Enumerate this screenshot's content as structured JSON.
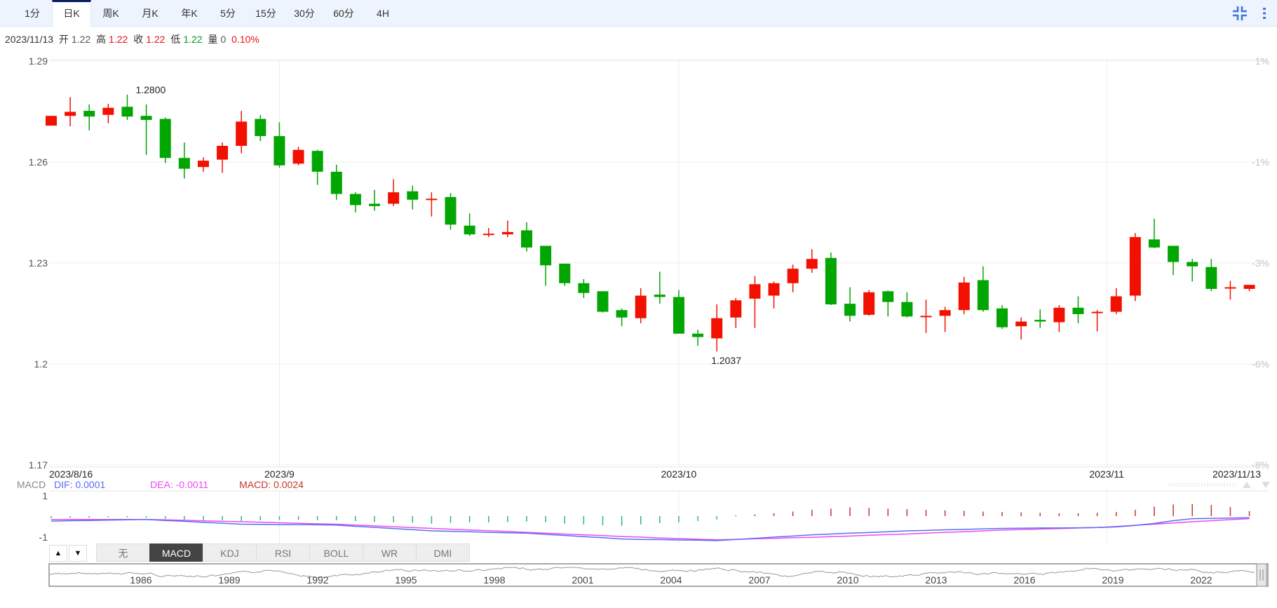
{
  "tabs": [
    "1分",
    "日K",
    "周K",
    "月K",
    "年K",
    "5分",
    "15分",
    "30分",
    "60分",
    "4H"
  ],
  "active_tab": "日K",
  "toolbar": {
    "compress_icon": "compress-icon",
    "more_icon": "more-vertical-icon"
  },
  "info": {
    "date": "2023/11/13",
    "open_label": "开",
    "open": "1.22",
    "high_label": "高",
    "high": "1.22",
    "close_label": "收",
    "close": "1.22",
    "low_label": "低",
    "low": "1.22",
    "volume_label": "量",
    "volume": "0",
    "change": "0.10%"
  },
  "colors": {
    "up": "#f21100",
    "down": "#02a602",
    "dif": "#5b6cf5",
    "dea": "#e84cf0",
    "macd_up": "#c0392b",
    "macd_down": "#2bb38a"
  },
  "chart_data": {
    "type": "candlestick",
    "ylim": [
      1.17,
      1.29
    ],
    "y_ticks": [
      "1.29",
      "1.26",
      "1.23",
      "1.2",
      "1.17"
    ],
    "y_tick_values": [
      1.29,
      1.26,
      1.23,
      1.2,
      1.17
    ],
    "pct_ticks": [
      "1%",
      "-1%",
      "-3%",
      "-6%",
      "-8%"
    ],
    "x_labels": {
      "start": "2023/8/16",
      "m1": "2023/9",
      "m2": "2023/10",
      "m3": "2023/11",
      "end": "2023/11/13"
    },
    "x_month_index": [
      12,
      33,
      55.5
    ],
    "annotations": {
      "max_label": "1.2800",
      "max_index": 4,
      "min_label": "1.2037",
      "min_index": 35
    },
    "ohlc": [
      [
        1.2708,
        1.2737,
        1.2708,
        1.2737
      ],
      [
        1.2737,
        1.2793,
        1.2706,
        1.2749
      ],
      [
        1.2752,
        1.2771,
        1.2694,
        1.2735
      ],
      [
        1.274,
        1.2773,
        1.2715,
        1.2761
      ],
      [
        1.2764,
        1.28,
        1.2725,
        1.2735
      ],
      [
        1.2737,
        1.2771,
        1.2621,
        1.2725
      ],
      [
        1.2728,
        1.2732,
        1.2597,
        1.2612
      ],
      [
        1.2612,
        1.2658,
        1.2551,
        1.258
      ],
      [
        1.2585,
        1.2614,
        1.2571,
        1.2604
      ],
      [
        1.2607,
        1.2658,
        1.2568,
        1.2648
      ],
      [
        1.2648,
        1.2752,
        1.2626,
        1.272
      ],
      [
        1.2728,
        1.274,
        1.2662,
        1.2677
      ],
      [
        1.2677,
        1.2718,
        1.2583,
        1.259
      ],
      [
        1.2595,
        1.2645,
        1.259,
        1.2636
      ],
      [
        1.2633,
        1.2636,
        1.2532,
        1.2571
      ],
      [
        1.2571,
        1.2592,
        1.2488,
        1.2505
      ],
      [
        1.2505,
        1.251,
        1.245,
        1.2472
      ],
      [
        1.2476,
        1.2517,
        1.2455,
        1.2469
      ],
      [
        1.2476,
        1.2549,
        1.2469,
        1.251
      ],
      [
        1.2513,
        1.253,
        1.2459,
        1.2488
      ],
      [
        1.2491,
        1.251,
        1.2438,
        1.2491
      ],
      [
        1.2496,
        1.2508,
        1.2399,
        1.2414
      ],
      [
        1.2411,
        1.2447,
        1.238,
        1.2385
      ],
      [
        1.2387,
        1.2404,
        1.2377,
        1.2387
      ],
      [
        1.2385,
        1.2426,
        1.2377,
        1.2392
      ],
      [
        1.2397,
        1.2421,
        1.2334,
        1.2346
      ],
      [
        1.2351,
        1.2351,
        1.2232,
        1.2293
      ],
      [
        1.2298,
        1.2298,
        1.2232,
        1.224
      ],
      [
        1.224,
        1.2252,
        1.2196,
        1.2211
      ],
      [
        1.2216,
        1.2216,
        1.2153,
        1.2155
      ],
      [
        1.216,
        1.2165,
        1.2112,
        1.2138
      ],
      [
        1.2136,
        1.2225,
        1.2121,
        1.2203
      ],
      [
        1.2206,
        1.2274,
        1.2179,
        1.2199
      ],
      [
        1.2199,
        1.222,
        1.209,
        1.209
      ],
      [
        1.209,
        1.2102,
        1.2054,
        1.208
      ],
      [
        1.2076,
        1.2177,
        1.2037,
        1.2136
      ],
      [
        1.2138,
        1.2196,
        1.2107,
        1.2189
      ],
      [
        1.2194,
        1.2261,
        1.2107,
        1.2237
      ],
      [
        1.2203,
        1.2245,
        1.2165,
        1.224
      ],
      [
        1.224,
        1.2295,
        1.2213,
        1.2283
      ],
      [
        1.2283,
        1.2341,
        1.2271,
        1.2312
      ],
      [
        1.2315,
        1.2331,
        1.2175,
        1.2177
      ],
      [
        1.2179,
        1.2228,
        1.2126,
        1.2143
      ],
      [
        1.2146,
        1.222,
        1.2143,
        1.2213
      ],
      [
        1.2216,
        1.2218,
        1.2141,
        1.2184
      ],
      [
        1.2184,
        1.2213,
        1.2138,
        1.2141
      ],
      [
        1.2143,
        1.2191,
        1.2092,
        1.2143
      ],
      [
        1.2143,
        1.217,
        1.2095,
        1.216
      ],
      [
        1.216,
        1.2259,
        1.2148,
        1.2242
      ],
      [
        1.2249,
        1.229,
        1.2155,
        1.216
      ],
      [
        1.2165,
        1.2175,
        1.2104,
        1.2109
      ],
      [
        1.2112,
        1.2138,
        1.2073,
        1.2126
      ],
      [
        1.2131,
        1.2162,
        1.2107,
        1.2126
      ],
      [
        1.2124,
        1.2175,
        1.2095,
        1.2167
      ],
      [
        1.2167,
        1.2201,
        1.2121,
        1.2148
      ],
      [
        1.2155,
        1.216,
        1.2097,
        1.2155
      ],
      [
        1.2155,
        1.2225,
        1.2148,
        1.2201
      ],
      [
        1.2203,
        1.2389,
        1.2187,
        1.2377
      ],
      [
        1.237,
        1.2431,
        1.2344,
        1.2346
      ],
      [
        1.2351,
        1.2351,
        1.2264,
        1.2303
      ],
      [
        1.2303,
        1.2312,
        1.2245,
        1.229
      ],
      [
        1.2288,
        1.2312,
        1.2216,
        1.2223
      ],
      [
        1.2228,
        1.2247,
        1.2191,
        1.2228
      ],
      [
        1.2223,
        1.2235,
        1.2216,
        1.2235
      ]
    ],
    "ohlc_order": "open,high,low,close"
  },
  "macd": {
    "title": "MACD",
    "dif_label": "DIF: 0.0001",
    "dea_label": "DEA: -0.0011",
    "macd_label": "MACD: 0.0024",
    "y_ticks": [
      "1",
      "-1"
    ],
    "dif": [
      -0.24,
      -0.22,
      -0.21,
      -0.19,
      -0.18,
      -0.16,
      -0.21,
      -0.25,
      -0.3,
      -0.34,
      -0.39,
      -0.4,
      -0.41,
      -0.41,
      -0.42,
      -0.43,
      -0.49,
      -0.54,
      -0.6,
      -0.65,
      -0.71,
      -0.73,
      -0.75,
      -0.78,
      -0.8,
      -0.82,
      -0.88,
      -0.93,
      -0.99,
      -1.04,
      -1.1,
      -1.12,
      -1.13,
      -1.15,
      -1.16,
      -1.18,
      -1.12,
      -1.07,
      -1.01,
      -0.96,
      -0.9,
      -0.86,
      -0.82,
      -0.79,
      -0.75,
      -0.71,
      -0.69,
      -0.66,
      -0.64,
      -0.61,
      -0.59,
      -0.58,
      -0.57,
      -0.57,
      -0.56,
      -0.55,
      -0.52,
      -0.45,
      -0.35,
      -0.22,
      -0.12,
      -0.11,
      -0.09,
      -0.08
    ],
    "dea": [
      -0.16,
      -0.16,
      -0.16,
      -0.16,
      -0.16,
      -0.16,
      -0.18,
      -0.2,
      -0.23,
      -0.25,
      -0.27,
      -0.29,
      -0.32,
      -0.34,
      -0.37,
      -0.39,
      -0.43,
      -0.47,
      -0.51,
      -0.55,
      -0.59,
      -0.63,
      -0.67,
      -0.7,
      -0.74,
      -0.78,
      -0.82,
      -0.86,
      -0.9,
      -0.94,
      -0.98,
      -1.01,
      -1.05,
      -1.08,
      -1.11,
      -1.14,
      -1.12,
      -1.09,
      -1.07,
      -1.04,
      -1.02,
      -0.99,
      -0.96,
      -0.92,
      -0.89,
      -0.86,
      -0.82,
      -0.78,
      -0.75,
      -0.71,
      -0.67,
      -0.65,
      -0.62,
      -0.6,
      -0.57,
      -0.55,
      -0.5,
      -0.44,
      -0.39,
      -0.33,
      -0.27,
      -0.22,
      -0.17,
      -0.12
    ],
    "hist": [
      -0.1,
      -0.08,
      -0.08,
      -0.06,
      -0.06,
      -0.08,
      -0.12,
      -0.16,
      -0.2,
      -0.2,
      -0.24,
      -0.2,
      -0.18,
      -0.18,
      -0.2,
      -0.2,
      -0.24,
      -0.28,
      -0.3,
      -0.32,
      -0.36,
      -0.32,
      -0.3,
      -0.3,
      -0.28,
      -0.26,
      -0.3,
      -0.36,
      -0.4,
      -0.44,
      -0.46,
      -0.4,
      -0.34,
      -0.3,
      -0.24,
      -0.16,
      0.04,
      0.08,
      0.14,
      0.22,
      0.3,
      0.36,
      0.42,
      0.4,
      0.36,
      0.34,
      0.3,
      0.28,
      0.26,
      0.22,
      0.2,
      0.18,
      0.16,
      0.14,
      0.14,
      0.16,
      0.2,
      0.3,
      0.46,
      0.56,
      0.58,
      0.54,
      0.44,
      0.24
    ]
  },
  "indicator_tabs": [
    "无",
    "MACD",
    "KDJ",
    "RSI",
    "BOLL",
    "WR",
    "DMI"
  ],
  "active_indicator": "MACD",
  "pane_buttons": {
    "up": "▲",
    "down": "▼"
  },
  "navigator": {
    "years": [
      "1986",
      "1989",
      "1992",
      "1995",
      "1998",
      "2001",
      "2004",
      "2007",
      "2010",
      "2013",
      "2016",
      "2019",
      "2022"
    ]
  }
}
